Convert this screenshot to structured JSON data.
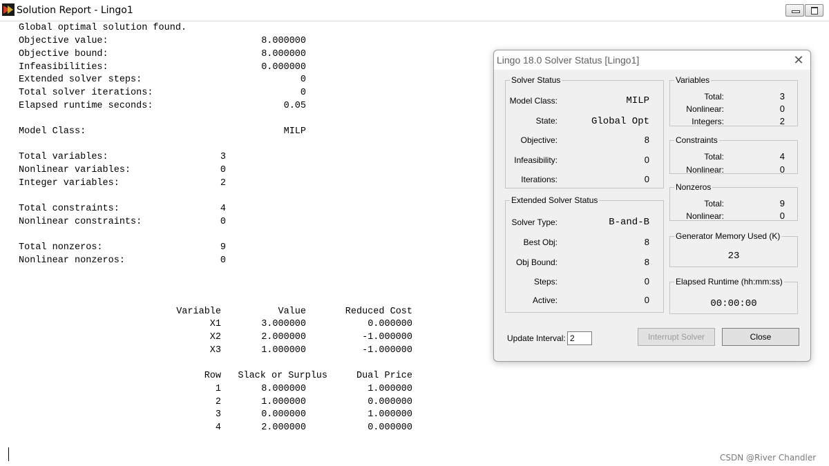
{
  "window": {
    "title": "Solution Report - Lingo1"
  },
  "report": {
    "summary_lines": [
      {
        "label": "Global optimal solution found.",
        "value": ""
      },
      {
        "label": "Objective value:",
        "value": "8.000000"
      },
      {
        "label": "Objective bound:",
        "value": "8.000000"
      },
      {
        "label": "Infeasibilities:",
        "value": "0.000000"
      },
      {
        "label": "Extended solver steps:",
        "value": "0"
      },
      {
        "label": "Total solver iterations:",
        "value": "0"
      },
      {
        "label": "Elapsed runtime seconds:",
        "value": "0.05"
      }
    ],
    "model_class": {
      "label": "Model Class:",
      "value": "MILP"
    },
    "variables_block": [
      {
        "label": "Total variables:",
        "value": "3"
      },
      {
        "label": "Nonlinear variables:",
        "value": "0"
      },
      {
        "label": "Integer variables:",
        "value": "2"
      }
    ],
    "constraints_block": [
      {
        "label": "Total constraints:",
        "value": "4"
      },
      {
        "label": "Nonlinear constraints:",
        "value": "0"
      }
    ],
    "nonzeros_block": [
      {
        "label": "Total nonzeros:",
        "value": "9"
      },
      {
        "label": "Nonlinear nonzeros:",
        "value": "0"
      }
    ],
    "variable_table": {
      "headers": [
        "Variable",
        "Value",
        "Reduced Cost"
      ],
      "rows": [
        [
          "X1",
          "3.000000",
          "0.000000"
        ],
        [
          "X2",
          "2.000000",
          "-1.000000"
        ],
        [
          "X3",
          "1.000000",
          "-1.000000"
        ]
      ]
    },
    "row_table": {
      "headers": [
        "Row",
        "Slack or Surplus",
        "Dual Price"
      ],
      "rows": [
        [
          "1",
          "8.000000",
          "1.000000"
        ],
        [
          "2",
          "1.000000",
          "0.000000"
        ],
        [
          "3",
          "0.000000",
          "1.000000"
        ],
        [
          "4",
          "2.000000",
          "0.000000"
        ]
      ]
    }
  },
  "solver_dialog": {
    "title": "Lingo 18.0 Solver Status [Lingo1]",
    "close_glyph": "✕",
    "solver_status": {
      "legend": "Solver Status",
      "model_class_label": "Model Class:",
      "model_class_value": "MILP",
      "state_label": "State:",
      "state_value": "Global Opt",
      "objective_label": "Objective:",
      "objective_value": "8",
      "infeasibility_label": "Infeasibility:",
      "infeasibility_value": "0",
      "iterations_label": "Iterations:",
      "iterations_value": "0"
    },
    "extended_status": {
      "legend": "Extended Solver Status",
      "solver_type_label": "Solver Type:",
      "solver_type_value": "B-and-B",
      "best_obj_label": "Best Obj:",
      "best_obj_value": "8",
      "obj_bound_label": "Obj Bound:",
      "obj_bound_value": "8",
      "steps_label": "Steps:",
      "steps_value": "0",
      "active_label": "Active:",
      "active_value": "0"
    },
    "variables": {
      "legend": "Variables",
      "total_label": "Total:",
      "total_value": "3",
      "nonlinear_label": "Nonlinear:",
      "nonlinear_value": "0",
      "integers_label": "Integers:",
      "integers_value": "2"
    },
    "constraints": {
      "legend": "Constraints",
      "total_label": "Total:",
      "total_value": "4",
      "nonlinear_label": "Nonlinear:",
      "nonlinear_value": "0"
    },
    "nonzeros": {
      "legend": "Nonzeros",
      "total_label": "Total:",
      "total_value": "9",
      "nonlinear_label": "Nonlinear:",
      "nonlinear_value": "0"
    },
    "memory": {
      "legend": "Generator Memory Used (K)",
      "value": "23"
    },
    "runtime": {
      "legend": "Elapsed Runtime (hh:mm:ss)",
      "value": "00:00:00"
    },
    "update_interval_label": "Update Interval:",
    "update_interval_value": "2",
    "interrupt_label": "Interrupt Solver",
    "close_label": "Close"
  },
  "watermark": "CSDN @River Chandler"
}
